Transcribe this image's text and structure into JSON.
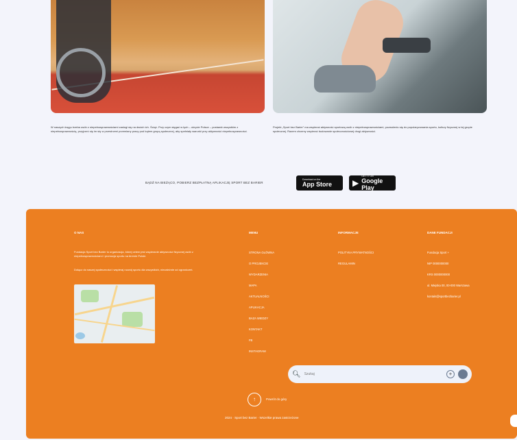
{
  "captions": {
    "left": "W naszych kręgu trzeba osób z niepełnosprawnościami zasługi się na dwóch ich. Ściąć. Przy czym sięgać w tych – ukrycie Polsce – postawić wszystkim z niepełnosprawnością, przyjrzeć się im się w przestrzeni przemiany pracy pod kątem grupą społecznej, aby spełniały warunki przy aktywności niepełnosprawności.",
    "right": "Projekt „Sport bez Barier” ma wspierać aktywność sportową osób z niepełnosprawnościami, pozwoleniu się do popularyzowania sportu, kultury fizycznej w tej grupie społecznej. Razem chcemy wspierać budowanie społecznościowej drogi aktywności."
  },
  "apps": {
    "promo_text": "BĄDŹ NA BIEŻĄCO, POBIERZ BEZPŁATNĄ APLIKACJĘ SPORT BEZ BARIER",
    "appstore_small": "Download on the",
    "appstore_big": "App Store",
    "googleplay_small": "GET IT ON",
    "googleplay_big": "Google Play"
  },
  "footer": {
    "contact_heading": "O NAS",
    "about_text": "Fundacja Sport bez Barier to organizacja, której celem jest wspieranie aktywności fizycznej osób z niepełnosprawnościami i promocja sportu na terenie Polski.",
    "about_text2": "Dołącz do naszej społeczności i wspieraj rozwój sportu dla wszystkich, niezależnie od ograniczeń.",
    "menu_heading": "MENU",
    "menu_items": [
      "STRONA GŁÓWNA",
      "O PROJEKCIE",
      "WYDARZENIA",
      "MAPA",
      "AKTUALNOŚCI",
      "APLIKACJA",
      "BAZA WIEDZY",
      "KONTAKT",
      "FB",
      "INSTAGRAM"
    ],
    "info_heading": "INFORMACJE",
    "info_items": [
      "POLITYKA PRYWATNOŚCI",
      "REGULAMIN"
    ],
    "org_heading": "DANE FUNDACJI",
    "org_items": [
      "Fundacja Sport +",
      "NIP 0000000000",
      "KRS 0000000000",
      "ul. Miejska 00, 00-000 Warszawa",
      "kontakt@sportbezbarier.pl"
    ],
    "search_placeholder": "Szukaj",
    "back_to_top": "Powrót do góry",
    "copyright": "2024 · Sport bez Barier · Wszelkie prawa zastrzeżone"
  },
  "colors": {
    "footer_bg": "#ec7f21",
    "page_bg": "#f3f4fb"
  }
}
